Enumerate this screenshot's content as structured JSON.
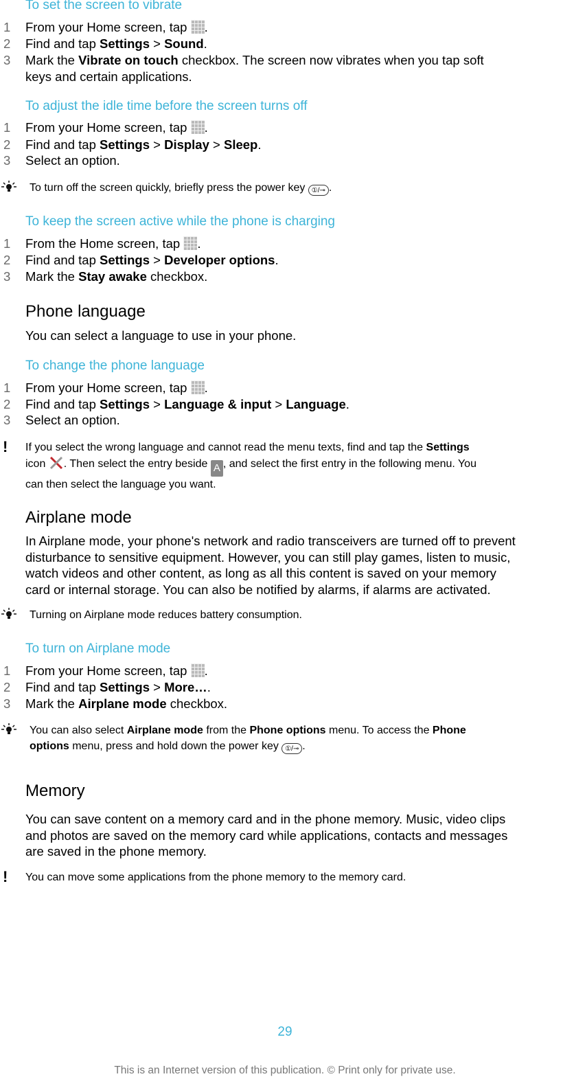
{
  "sections": {
    "vibrate": {
      "title": "To set the screen to vibrate",
      "steps": [
        {
          "num": "1",
          "pre": "From your Home screen, tap ",
          "post": "."
        },
        {
          "num": "2",
          "pre": "Find and tap ",
          "b1": "Settings",
          "mid": " > ",
          "b2": "Sound",
          "post": "."
        },
        {
          "num": "3",
          "pre": "Mark the ",
          "b1": "Vibrate on touch",
          "line1": " checkbox. The screen now vibrates when you tap soft",
          "line2": "keys and certain applications."
        }
      ]
    },
    "idle": {
      "title": "To adjust the idle time before the screen turns off",
      "steps": [
        {
          "num": "1",
          "pre": "From your Home screen, tap ",
          "post": "."
        },
        {
          "num": "2",
          "pre": "Find and tap ",
          "b1": "Settings",
          "mid": " > ",
          "b2": "Display",
          "mid2": " > ",
          "b3": "Sleep",
          "post": "."
        },
        {
          "num": "3",
          "text": "Select an option."
        }
      ],
      "tip": {
        "pre": "To turn off the screen quickly, briefly press the power key ",
        "post": "."
      }
    },
    "charging": {
      "title": "To keep the screen active while the phone is charging",
      "steps": [
        {
          "num": "1",
          "pre": "From the Home screen, tap ",
          "post": "."
        },
        {
          "num": "2",
          "pre": "Find and tap ",
          "b1": "Settings",
          "mid": " > ",
          "b2": "Developer options",
          "post": "."
        },
        {
          "num": "3",
          "pre": "Mark the ",
          "b1": "Stay awake",
          "post": " checkbox."
        }
      ]
    },
    "language": {
      "heading": "Phone language",
      "intro": "You can select a language to use in your phone.",
      "title": "To change the phone language",
      "steps": [
        {
          "num": "1",
          "pre": "From your Home screen, tap ",
          "post": "."
        },
        {
          "num": "2",
          "pre": "Find and tap ",
          "b1": "Settings",
          "mid": " > ",
          "b2": "Language & input",
          "mid2": " > ",
          "b3": "Language",
          "post": "."
        },
        {
          "num": "3",
          "text": "Select an option."
        }
      ],
      "note": {
        "l1pre": "If you select the wrong language and cannot read the menu texts, find and tap the ",
        "l1b": "Settings",
        "l2a": "icon ",
        "l2b": ". Then select the entry beside ",
        "l2c": ", and select the first entry in the following menu. You",
        "l3": "can then select the language you want."
      }
    },
    "airplane": {
      "heading": "Airplane mode",
      "para": [
        "In Airplane mode, your phone's network and radio transceivers are turned off to prevent",
        "disturbance to sensitive equipment. However, you can still play games, listen to music,",
        "watch videos and other content, as long as all this content is saved on your memory",
        "card or internal storage. You can also be notified by alarms, if alarms are activated."
      ],
      "tip": "Turning on Airplane mode reduces battery consumption.",
      "title": "To turn on Airplane mode",
      "steps": [
        {
          "num": "1",
          "pre": "From your Home screen, tap ",
          "post": "."
        },
        {
          "num": "2",
          "pre": "Find and tap ",
          "b1": "Settings",
          "mid": " > ",
          "b2": "More…",
          "post": "."
        },
        {
          "num": "3",
          "pre": "Mark the ",
          "b1": "Airplane mode",
          "post": " checkbox."
        }
      ],
      "tip2": {
        "a": "You can also select ",
        "b": "Airplane mode",
        "c": " from the ",
        "d": "Phone options",
        "e": " menu. To access the ",
        "f": "Phone",
        "g": "options",
        "h": " menu, press and hold down the power key ",
        "i": "."
      }
    },
    "memory": {
      "heading": "Memory",
      "para": [
        "You can save content on a memory card and in the phone memory. Music, video clips",
        "and photos are saved on the memory card while applications, contacts and messages",
        "are saved in the phone memory."
      ],
      "note": "You can move some applications from the phone memory to the memory card."
    }
  },
  "icons": {
    "power": "①/⊸",
    "a": "A"
  },
  "footer": {
    "page": "29",
    "notice": "This is an Internet version of this publication. © Print only for private use."
  }
}
